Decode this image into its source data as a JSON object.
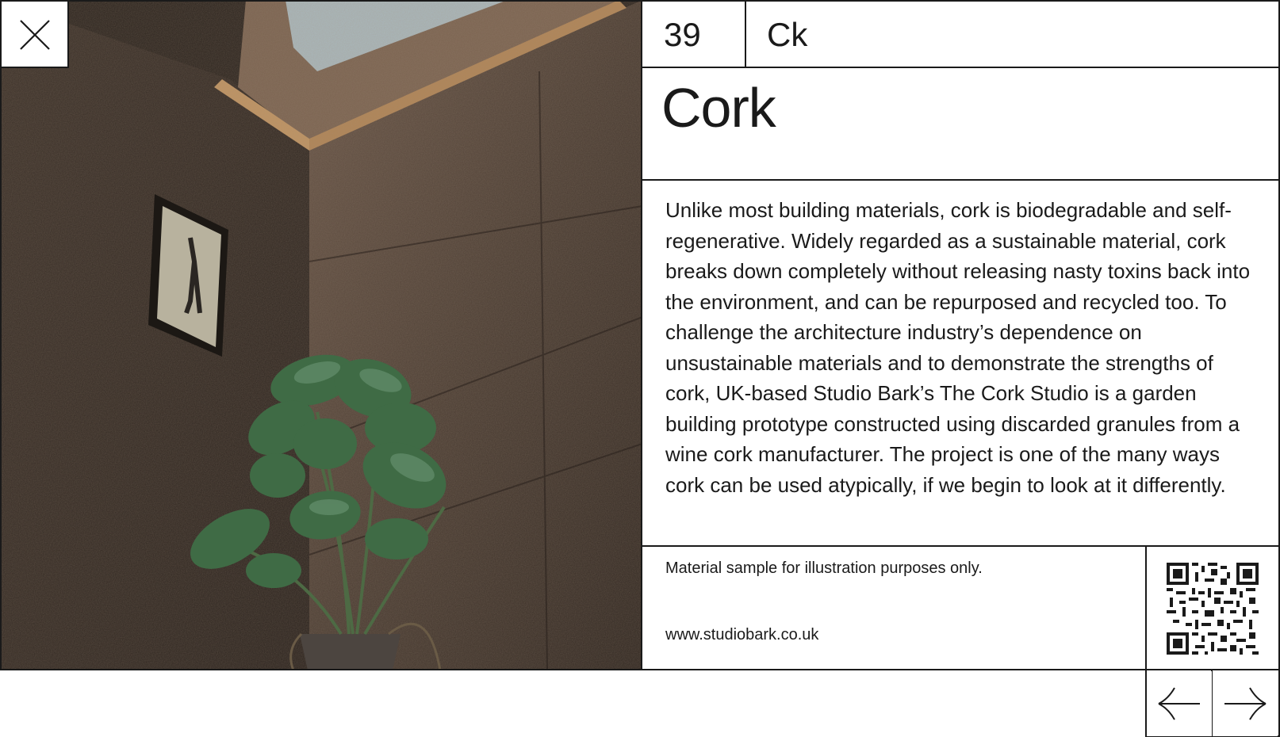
{
  "element": {
    "number": "39",
    "symbol": "Ck",
    "name": "Cork"
  },
  "description": "Unlike most building materials, cork is biodegradable and self-regenerative. Widely regarded as a sustainable material, cork breaks down completely without releasing nasty toxins back into the environment, and can be repurposed and recycled too. To challenge the architecture industry’s dependence on unsustainable materials and to demonstrate the strengths of cork, UK-based Studio Bark’s The Cork Studio is a garden building prototype constructed using discarded granules from a wine cork manufacturer. The project is one of the many ways cork can be used atypically, if we begin to look at it differently.",
  "footer": {
    "disclaimer": "Material sample for illustration purposes only.",
    "url": "www.studiobark.co.uk"
  },
  "icons": {
    "close": "close-icon",
    "prev": "arrow-left-icon",
    "next": "arrow-right-icon",
    "qr": "qr-code-icon"
  },
  "colors": {
    "ink": "#1a1a1a",
    "background": "#ffffff",
    "cork_wall": "#3a2e26",
    "plant": "#3f6b45"
  }
}
